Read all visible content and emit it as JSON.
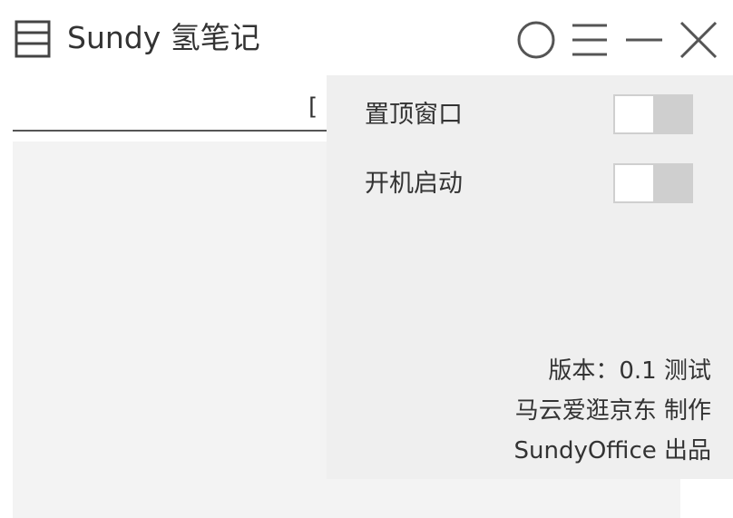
{
  "app": {
    "title": "Sundy 氢笔记",
    "icon": "notebook-icon"
  },
  "titlebar_buttons": [
    {
      "name": "circle-icon"
    },
    {
      "name": "menu-icon"
    },
    {
      "name": "minimize-icon"
    },
    {
      "name": "close-icon"
    }
  ],
  "editor": {
    "partial_text": "[",
    "colors": {
      "editor_bg": "#f3f3f3",
      "panel_bg": "#efefef",
      "toggle_off": "#cfcfcf"
    }
  },
  "settings": {
    "items": [
      {
        "label": "置顶窗口",
        "enabled": false
      },
      {
        "label": "开机启动",
        "enabled": false
      }
    ],
    "footer": {
      "version": "版本：0.1 测试",
      "author": "马云爱逛京东 制作",
      "publisher": "SundyOffice 出品"
    }
  }
}
